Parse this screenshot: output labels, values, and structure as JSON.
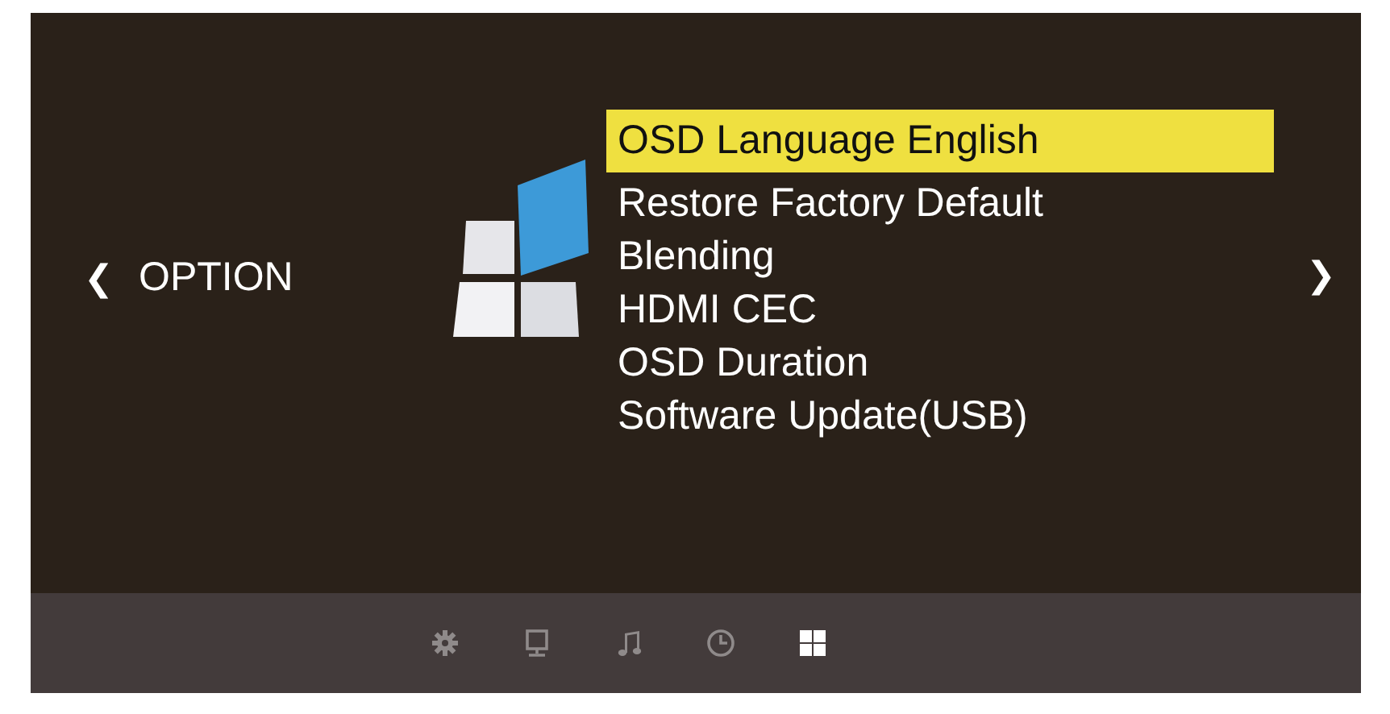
{
  "header": {
    "back_arrow": "❮",
    "title": "OPTION",
    "next_arrow": "❯"
  },
  "menu": {
    "items": [
      {
        "label": "OSD Language English",
        "selected": true
      },
      {
        "label": "Restore Factory Default",
        "selected": false
      },
      {
        "label": "Blending",
        "selected": false
      },
      {
        "label": "HDMI CEC",
        "selected": false
      },
      {
        "label": "OSD Duration",
        "selected": false
      },
      {
        "label": "Software Update(USB)",
        "selected": false
      }
    ]
  },
  "tabs": [
    {
      "kind": "gear",
      "selected": false
    },
    {
      "kind": "monitor",
      "selected": false
    },
    {
      "kind": "music",
      "selected": false
    },
    {
      "kind": "clock",
      "selected": false
    },
    {
      "kind": "grid",
      "selected": true
    }
  ]
}
